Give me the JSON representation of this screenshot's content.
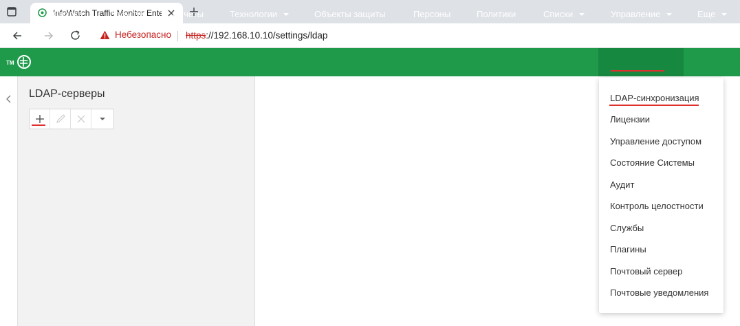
{
  "browser": {
    "tab_title": "InfoWatch Traffic Monitor Enterp",
    "security_label": "Небезопасно",
    "url_scheme": "https",
    "url_rest": "://192.168.10.10/settings/ldap"
  },
  "nav": {
    "items": [
      {
        "label": "Сводка",
        "dropdown": false
      },
      {
        "label": "События",
        "dropdown": false
      },
      {
        "label": "Отчеты",
        "dropdown": false
      },
      {
        "label": "Технологии",
        "dropdown": true
      },
      {
        "label": "Объекты защиты",
        "dropdown": false
      },
      {
        "label": "Персоны",
        "dropdown": false
      },
      {
        "label": "Политики",
        "dropdown": false
      },
      {
        "label": "Списки",
        "dropdown": true
      },
      {
        "label": "Управление",
        "dropdown": true
      },
      {
        "label": "Еще",
        "dropdown": true
      }
    ],
    "active": "Управление"
  },
  "left_panel": {
    "title": "LDAP-серверы",
    "toolbar": [
      "add-icon",
      "edit-icon",
      "delete-icon",
      "caret-down-icon"
    ]
  },
  "menu": {
    "items": [
      "LDAP-синхронизация",
      "Лицензии",
      "Управление доступом",
      "Состояние Системы",
      "Аудит",
      "Контроль целостности",
      "Службы",
      "Плагины",
      "Почтовый сервер",
      "Почтовые уведомления"
    ]
  },
  "colors": {
    "nav_bg": "#1f9a4a",
    "nav_active": "#178840",
    "highlight": "#e0302e"
  }
}
